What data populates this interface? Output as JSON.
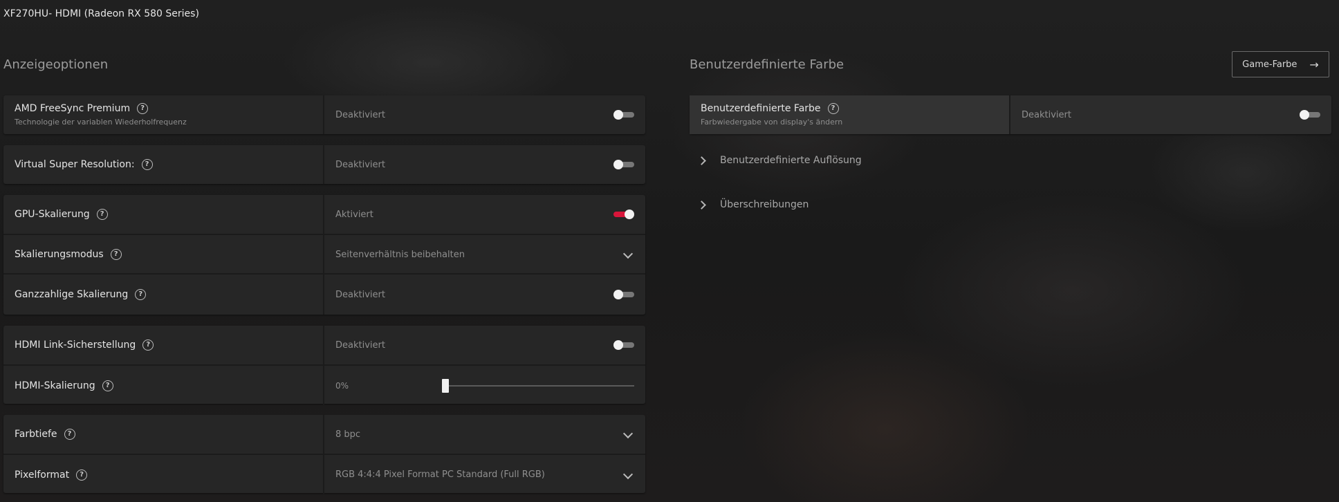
{
  "window": {
    "title": "XF270HU- HDMI (Radeon RX 580 Series)"
  },
  "left": {
    "section_title": "Anzeigeoptionen",
    "freesync": {
      "label": "AMD FreeSync Premium",
      "sub": "Technologie der variablen Wiederholfrequenz",
      "value": "Deaktiviert",
      "on": false
    },
    "vsr": {
      "label": "Virtual Super Resolution:",
      "value": "Deaktiviert",
      "on": false
    },
    "gpu_scaling": {
      "label": "GPU-Skalierung",
      "value": "Aktiviert",
      "on": true
    },
    "scaling_mode": {
      "label": "Skalierungsmodus",
      "value": "Seitenverhältnis beibehalten"
    },
    "integer_scaling": {
      "label": "Ganzzahlige Skalierung",
      "value": "Deaktiviert",
      "on": false
    },
    "hdmi_link": {
      "label": "HDMI Link-Sicherstellung",
      "value": "Deaktiviert",
      "on": false
    },
    "hdmi_scaling": {
      "label": "HDMI-Skalierung",
      "value": "0%",
      "level_percent": 0
    },
    "color_depth": {
      "label": "Farbtiefe",
      "value": "8 bpc"
    },
    "pixel_format": {
      "label": "Pixelformat",
      "value": "RGB 4:4:4 Pixel Format PC Standard (Full RGB)"
    }
  },
  "right": {
    "section_title": "Benutzerdefinierte Farbe",
    "game_color_button": "Game-Farbe",
    "custom_color": {
      "label": "Benutzerdefinierte Farbe",
      "sub": "Farbwiedergabe von display's ändern",
      "value": "Deaktiviert",
      "on": false
    },
    "expanders": [
      "Benutzerdefinierte Auflösung",
      "Überschreibungen"
    ]
  },
  "icons": {
    "help": "help-circle-icon",
    "arrow": "arrow-right-icon",
    "chevron_down": "chevron-down-icon",
    "chevron_right": "chevron-right-icon"
  },
  "colors": {
    "accent": "#d8153a",
    "panel": "#262626",
    "background": "#1b1b1b"
  }
}
